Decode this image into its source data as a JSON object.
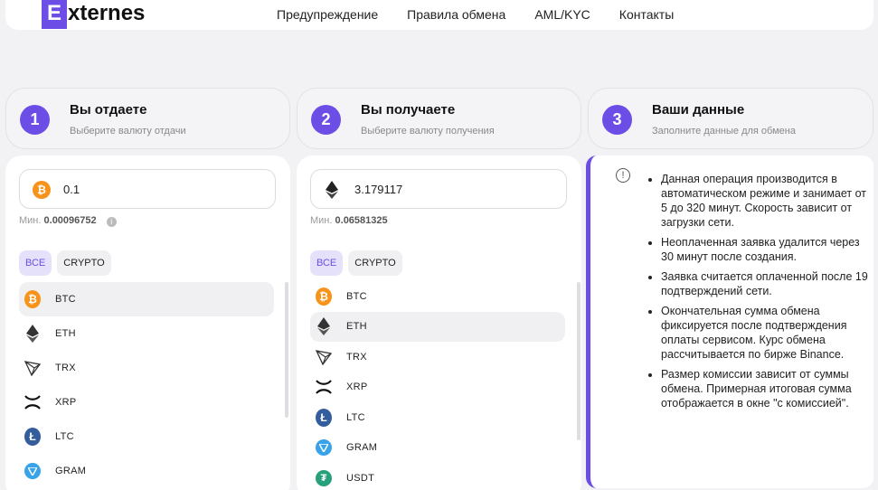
{
  "brand": {
    "letter": "E",
    "rest": "xternes",
    "accent": "#6c4ee6"
  },
  "nav": [
    "Предупреждение",
    "Правила обмена",
    "AML/KYC",
    "Контакты"
  ],
  "steps": [
    {
      "num": "1",
      "title": "Вы отдаете",
      "subtitle": "Выберите валюту отдачи"
    },
    {
      "num": "2",
      "title": "Вы получаете",
      "subtitle": "Выберите валюту получения"
    },
    {
      "num": "3",
      "title": "Ваши данные",
      "subtitle": "Заполните данные для обмена"
    }
  ],
  "give": {
    "amount": "0.1",
    "coin_icon": "bitcoin-icon",
    "min_label": "Мин.",
    "min_value": "0.00096752",
    "filters": [
      "ВСЕ",
      "CRYPTO"
    ],
    "currencies": [
      "BTC",
      "ETH",
      "TRX",
      "XRP",
      "LTC",
      "GRAM"
    ],
    "selected": "BTC"
  },
  "receive": {
    "amount": "3.179117",
    "coin_icon": "ethereum-icon",
    "min_label": "Мин.",
    "min_value": "0.06581325",
    "filters": [
      "ВСЕ",
      "CRYPTO"
    ],
    "currencies": [
      "BTC",
      "ETH",
      "TRX",
      "XRP",
      "LTC",
      "GRAM",
      "USDT"
    ],
    "selected": "ETH"
  },
  "info": [
    "Данная операция производится в автоматическом режиме и занимает от 5 до 320 минут. Скорость зависит от загрузки сети.",
    "Неоплаченная заявка удалится через 30 минут после создания.",
    "Заявка считается оплаченной после 19 подтверждений сети.",
    "Окончательная сумма обмена фиксируется после подтверждения оплаты сервисом. Курс обмена рассчитывается по бирже Binance.",
    "Размер комиссии зависит от суммы обмена. Примерная итоговая сумма отображается в окне \"с комиссией\"."
  ]
}
